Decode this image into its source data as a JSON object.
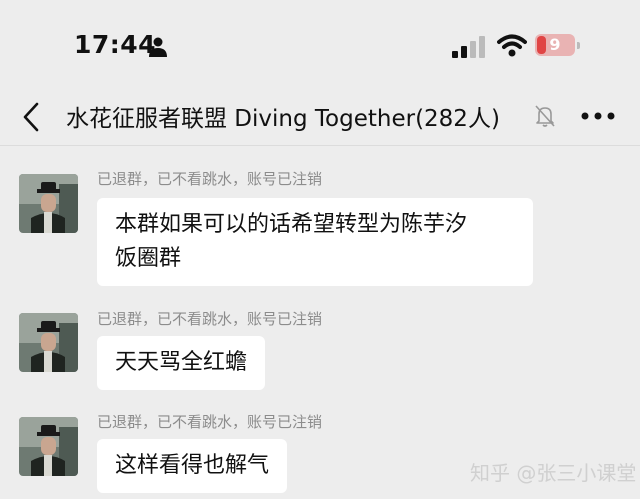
{
  "status_bar": {
    "time": "17:44",
    "battery": "9"
  },
  "header": {
    "title": "水花征服者联盟 Diving Together(282人)"
  },
  "messages": [
    {
      "sender": "已退群，已不看跳水，账号已注销",
      "lines": [
        "本群如果可以的话希望转型为陈芋汐",
        "饭圈群"
      ]
    },
    {
      "sender": "已退群，已不看跳水，账号已注销",
      "lines": [
        "天天骂全红蟾"
      ]
    },
    {
      "sender": "已退群，已不看跳水，账号已注销",
      "lines": [
        "这样看得也解气"
      ]
    }
  ],
  "watermark": "知乎 @张三小课堂"
}
